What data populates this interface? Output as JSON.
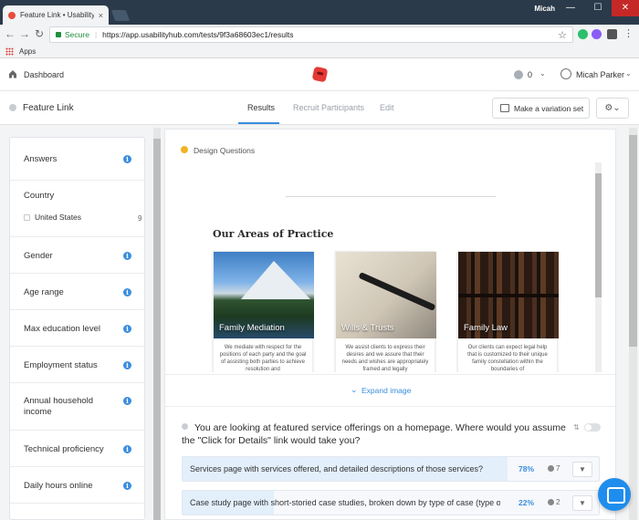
{
  "browser": {
    "tab_title": "Feature Link • UsabilityHub",
    "tab_close": "×",
    "user": "Micah",
    "secure_label": "Secure",
    "url": "https://app.usabilityhub.com/tests/9f3a68603ec1/results",
    "bookmarks_label": "Apps"
  },
  "header": {
    "dashboard": "Dashboard",
    "credits": "0",
    "user_name": "Micah Parker"
  },
  "subnav": {
    "test_name": "Feature Link",
    "tabs": [
      {
        "label": "Results",
        "active": true
      },
      {
        "label": "Recruit Participants",
        "active": false
      },
      {
        "label": "Edit",
        "active": false
      }
    ],
    "variation_button": "Make a variation set"
  },
  "sidebar": {
    "filters": [
      "Answers",
      "Country",
      "Gender",
      "Age range",
      "Max education level",
      "Employment status",
      "Annual household income",
      "Technical proficiency",
      "Daily hours online"
    ],
    "country_option": {
      "label": "United States",
      "count": "9"
    }
  },
  "main": {
    "section_label": "Design Questions",
    "preview": {
      "heading": "Our Areas of Practice",
      "cards": [
        {
          "title": "Family Mediation",
          "text": "We mediate with respect for the positions of each party and the goal of assisting both parties to achieve resolution and"
        },
        {
          "title": "Wills & Trusts",
          "text": "We assist clients to express their desires and we assure that their needs and wishes are appropriately framed and legally"
        },
        {
          "title": "Family Law",
          "text": "Our clients can expect legal help that is customized to their unique family constellation within the boundaries of"
        }
      ]
    },
    "expand_label": "Expand image",
    "question": "You are looking at featured service offerings on a homepage. Where would you assume the \"Click for Details\" link would take you?",
    "answers": [
      {
        "text": "Services page with services offered, and detailed descriptions of those services?",
        "pct": "78%",
        "count": "7",
        "fraction": 0.78
      },
      {
        "text": "Case study page with short-storied case studies, broken down by type of case (type of",
        "pct": "22%",
        "count": "2",
        "fraction": 0.22
      }
    ]
  },
  "colors": {
    "accent": "#3a8dde",
    "brand": "#e53935",
    "status_yellow": "#f0b323"
  },
  "icons": [
    "home-icon",
    "logo-icon",
    "user-icon",
    "gear-icon",
    "info-icon",
    "chevron-down-icon",
    "person-icon",
    "filter-icon",
    "chat-icon"
  ]
}
